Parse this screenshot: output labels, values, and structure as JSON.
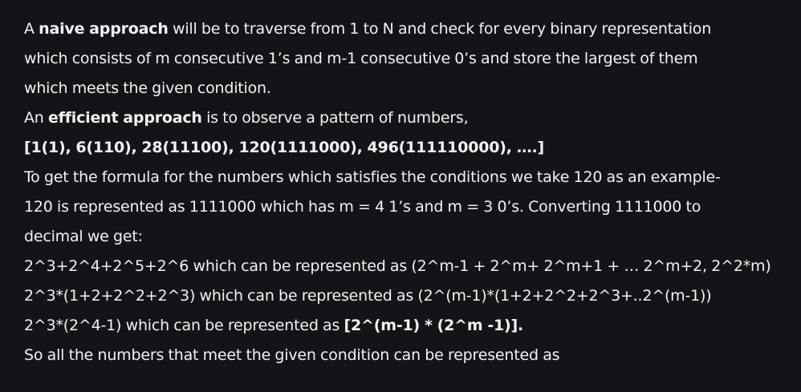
{
  "article": {
    "line1": {
      "pre": "A ",
      "bold": "naive approach",
      "post": " will be to traverse from 1 to N and check for every binary representation"
    },
    "line2": "which consists of m consecutive 1’s and m-1 consecutive 0’s and store the largest of them",
    "line3": "which meets the given condition.",
    "line4": {
      "pre": "An ",
      "bold": "efficient approach",
      "post": " is to observe a pattern of numbers,"
    },
    "line5": "[1(1), 6(110), 28(11100), 120(1111000), 496(111110000), ….]",
    "line6": "To get the formula for the numbers which satisfies the conditions we take 120 as an example-",
    "line7": "120 is represented as 1111000 which has m = 4 1’s and m = 3 0’s. Converting 1111000 to",
    "line8": "decimal we get:",
    "line9": "2^3+2^4+2^5+2^6 which can be represented as (2^m-1 + 2^m+ 2^m+1 + … 2^m+2, 2^2*m)",
    "line10": "2^3*(1+2+2^2+2^3) which can be represented as (2^(m-1)*(1+2+2^2+2^3+..2^(m-1))",
    "line11": {
      "pre": "2^3*(2^4-1) which can be represented as ",
      "bold": "[2^(m-1) * (2^m -1)]."
    },
    "line12": "So all the numbers that meet the given condition can be represented as"
  }
}
